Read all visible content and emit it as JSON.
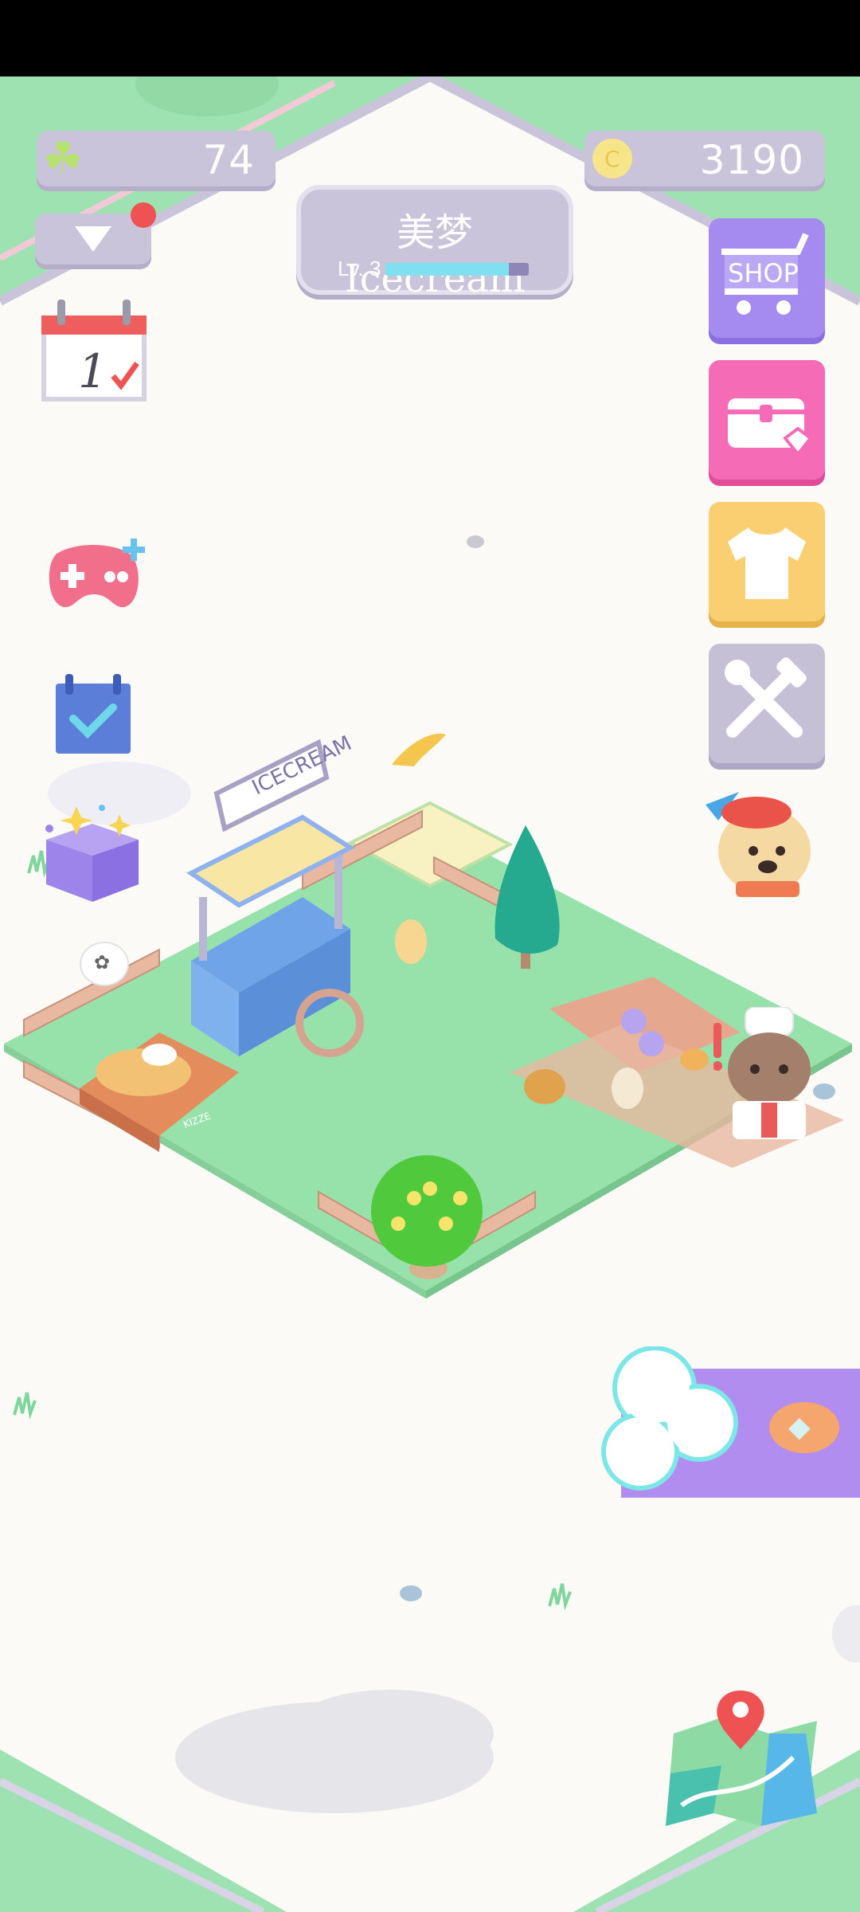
{
  "status_bar": {},
  "top_bar": {
    "clover": {
      "icon": "clover-icon",
      "value": "74"
    },
    "player": {
      "name": "美梦 Icecream",
      "level_label": "Lv. 3",
      "xp_progress": 0.86
    },
    "coins": {
      "icon": "coin-icon",
      "symbol": "C",
      "value": "3190"
    }
  },
  "left_menu": [
    {
      "id": "collapse",
      "icon": "triangle-down-icon",
      "badge": true
    },
    {
      "id": "daily-checkin",
      "icon": "calendar-icon",
      "calendar_day": "1"
    },
    {
      "id": "minigames",
      "icon": "gamepad-icon"
    },
    {
      "id": "tasks",
      "icon": "checklist-icon"
    },
    {
      "id": "gift-box",
      "icon": "mystery-box-icon"
    }
  ],
  "right_menu": [
    {
      "id": "shop",
      "icon": "cart-icon",
      "label": "SHOP",
      "color": "#a58bf0"
    },
    {
      "id": "treasure",
      "icon": "treasure-chest-icon",
      "color": "#f56bb5"
    },
    {
      "id": "wardrobe",
      "icon": "tshirt-icon",
      "color": "#f9cf72"
    },
    {
      "id": "build",
      "icon": "tools-icon",
      "color": "#c5c0d6"
    }
  ],
  "scene": {
    "shop_sign": "ICECREAM",
    "bed_label": "KIZZE",
    "thought_icon": "flower-icon",
    "quest_visitor_icon": "poodle-visitor-icon",
    "alert_visitor_icon": "cat-chef-visitor-icon"
  },
  "cloud_panel": {
    "icon": "cloud-icon",
    "reward_icon": "diamond-icon"
  },
  "map_button": {
    "icon": "map-pin-icon"
  },
  "colors": {
    "green_border": "#9ee2b2",
    "grass": "#97e2ab",
    "purple_ui": "#c9c4d9",
    "purple_panel": "#b28df0"
  }
}
